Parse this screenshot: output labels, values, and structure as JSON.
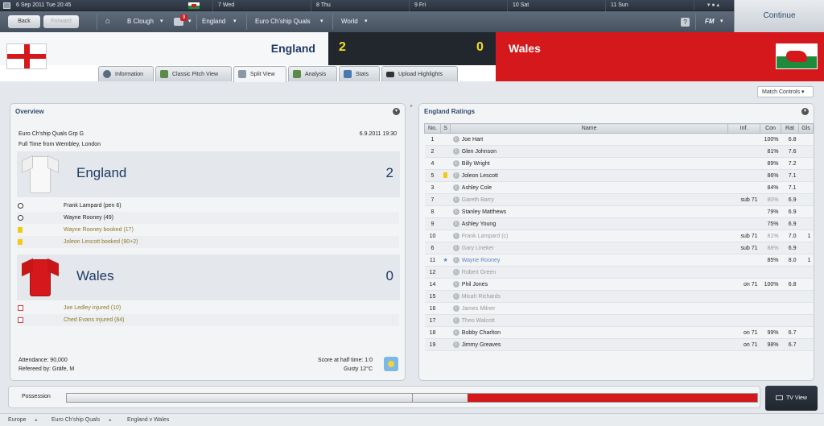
{
  "datebar": {
    "current": "6 Sep 2011 Tue 20:45",
    "days": [
      "7 Wed",
      "8 Thu",
      "9 Fri",
      "10 Sat",
      "11 Sun"
    ]
  },
  "nav": {
    "back": "Back",
    "forward": "Forward",
    "manager": "B Clough",
    "inbox_count": "9",
    "nation": "England",
    "competition": "Euro Ch'ship Quals",
    "world": "World",
    "help": "?",
    "fm": "FM"
  },
  "continue_label": "Continue",
  "match": {
    "home_team": "England",
    "away_team": "Wales",
    "home_score": "2",
    "away_score": "0"
  },
  "tabs": [
    "Information",
    "Classic Pitch View",
    "Split View",
    "Analysis",
    "Stats",
    "Upload Highlights"
  ],
  "match_controls": "Match Controls",
  "overview": {
    "title": "Overview",
    "competition": "Euro Ch'ship Quals Grp G",
    "date": "6.9.2011 19:30",
    "venue": "Full Time from Wembley, London",
    "home_team": "England",
    "home_score": "2",
    "home_events": [
      "Frank Lampard (pen 6)",
      "Wayne Rooney (49)",
      "Wayne Rooney booked (17)",
      "Joleon Lescott booked (90+2)"
    ],
    "away_team": "Wales",
    "away_score": "0",
    "away_events": [
      "Joe Ledley injured (10)",
      "Ched Evans injured (84)"
    ],
    "attendance": "Attendance: 90,000",
    "referee": "Refereed by: Gräfe, M",
    "halftime": "Score at half time: 1:0",
    "weather": "Gusty 12°C"
  },
  "ratings": {
    "title": "England Ratings",
    "headers": [
      "No.",
      "S",
      "Name",
      "Inf.",
      "Con",
      "Rat",
      "Gls"
    ],
    "rows": [
      [
        "1",
        "",
        "Joe Hart",
        "",
        "100%",
        "6.8",
        ""
      ],
      [
        "2",
        "",
        "Glen Johnson",
        "",
        "81%",
        "7.6",
        ""
      ],
      [
        "4",
        "",
        "Billy Wright",
        "",
        "89%",
        "7.2",
        ""
      ],
      [
        "5",
        "yellow",
        "Joleon Lescott",
        "",
        "86%",
        "7.1",
        ""
      ],
      [
        "3",
        "",
        "Ashley Cole",
        "",
        "84%",
        "7.1",
        ""
      ],
      [
        "7",
        "",
        "Gareth Barry",
        "sub 71",
        "80%",
        "6.9",
        ""
      ],
      [
        "8",
        "",
        "Stanley Matthews",
        "",
        "79%",
        "6.9",
        ""
      ],
      [
        "9",
        "",
        "Ashley Young",
        "",
        "75%",
        "6.9",
        ""
      ],
      [
        "10",
        "",
        "Frank Lampard (c)",
        "sub 71",
        "81%",
        "7.0",
        "1"
      ],
      [
        "6",
        "",
        "Gary Lineker",
        "sub 71",
        "88%",
        "6.9",
        ""
      ],
      [
        "11",
        "star",
        "Wayne Rooney",
        "",
        "85%",
        "8.0",
        "1"
      ],
      [
        "12",
        "",
        "Robert Green",
        "",
        "",
        "",
        ""
      ],
      [
        "14",
        "",
        "Phil Jones",
        "on 71",
        "100%",
        "6.8",
        ""
      ],
      [
        "15",
        "",
        "Micah Richards",
        "",
        "",
        "",
        ""
      ],
      [
        "16",
        "",
        "James Milner",
        "",
        "",
        "",
        ""
      ],
      [
        "17",
        "",
        "Theo Walcott",
        "",
        "",
        "",
        ""
      ],
      [
        "18",
        "",
        "Bobby Charlton",
        "on 71",
        "99%",
        "6.7",
        ""
      ],
      [
        "19",
        "",
        "Jimmy Greaves",
        "on 71",
        "98%",
        "6.7",
        ""
      ]
    ]
  },
  "possession": {
    "label": "Possession",
    "home_fraction": 0.58
  },
  "tv_view": "TV View",
  "breadcrumbs": [
    "Europe",
    "Euro Ch'ship Quals",
    "England v Wales"
  ]
}
